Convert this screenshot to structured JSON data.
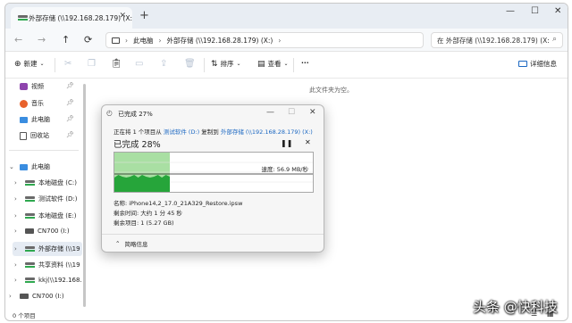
{
  "tab": {
    "title": "外部存储 (\\\\192.168.28.179) (X:",
    "close": "✕",
    "new": "+"
  },
  "window_controls": {
    "minimize": "—",
    "maximize": "☐",
    "close": "✕"
  },
  "address": {
    "segment1": "此电脑",
    "segment2": "外部存储 (\\\\192.168.28.179) (X:)",
    "search_placeholder": "在 外部存储 (\\\\192.168.28.179) (X:"
  },
  "toolbar": {
    "new_label": "新建",
    "sort_label": "排序",
    "view_label": "查看",
    "more_label": "···",
    "details_label": "详细信息"
  },
  "sidebar": {
    "quick": [
      {
        "label": "视频",
        "icon": "video-icon"
      },
      {
        "label": "音乐",
        "icon": "music-icon"
      },
      {
        "label": "此电脑",
        "icon": "pc-icon"
      },
      {
        "label": "回收站",
        "icon": "recycle-bin-icon"
      }
    ],
    "tree": [
      {
        "label": "此电脑",
        "level": 0,
        "expanded": true
      },
      {
        "label": "本地磁盘 (C:)",
        "level": 1
      },
      {
        "label": "测试软件 (D:)",
        "level": 1
      },
      {
        "label": "本地磁盘 (E:)",
        "level": 1
      },
      {
        "label": "CN700 (I:)",
        "level": 1
      },
      {
        "label": "外部存储 (\\\\19",
        "level": 1,
        "selected": true
      },
      {
        "label": "共享资料 (\\\\19",
        "level": 1
      },
      {
        "label": "kkj(\\\\192.168.",
        "level": 1
      },
      {
        "label": "CN700 (I:)",
        "level": 0
      }
    ]
  },
  "content": {
    "empty_message": "此文件夹为空。"
  },
  "status": {
    "item_count": "0 个项目"
  },
  "dialog": {
    "title": "已完成 27%",
    "line_prefix": "正在将 1 个项目从",
    "source": "测试软件 (D:)",
    "line_mid": "复制到",
    "destination": "外部存储 (\\\\192.168.28.179) (X:)",
    "percent_text": "已完成 28%",
    "progress": 0.28,
    "speed": "速度: 56.9 MB/秒",
    "name_line": "名称: iPhone14,2_17.0_21A329_Restore.ipsw",
    "time_line": "剩余时间: 大约 1 分 45 秒",
    "items_line": "剩余项目: 1 (5.27 GB)",
    "less_info": "简略信息"
  },
  "watermark": "头条 @快科技",
  "colors": {
    "accent": "#1a67c2",
    "graph_fill": "#26a53a",
    "graph_bg": "#a9dfa3"
  }
}
